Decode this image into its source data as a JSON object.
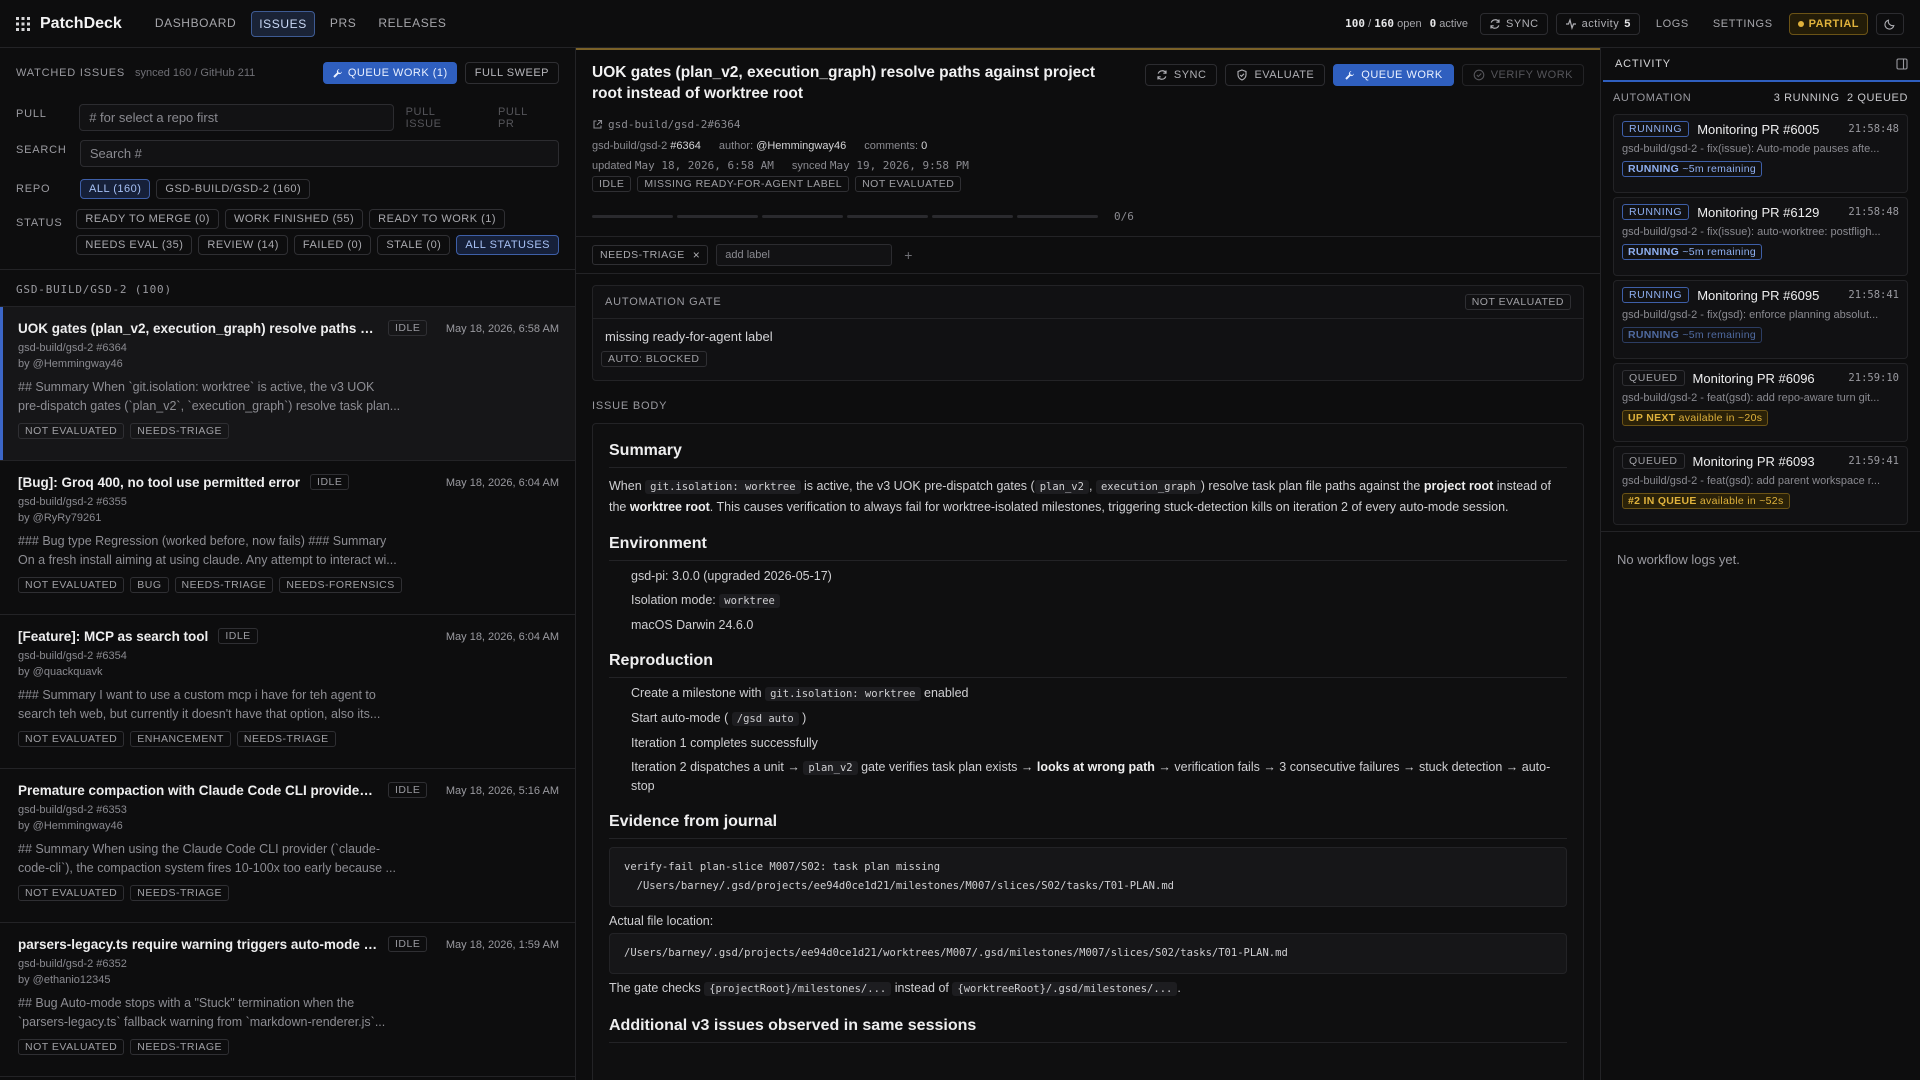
{
  "app": {
    "name": "PatchDeck"
  },
  "nav": [
    "DASHBOARD",
    "ISSUES",
    "PRS",
    "RELEASES"
  ],
  "top": {
    "open_a": "100",
    "open_sep": "/",
    "open_b": "160",
    "open_label": "open",
    "active_num": "0",
    "active_label": "active",
    "sync": "SYNC",
    "activity": "activity",
    "activity_count": "5",
    "logs": "LOGS",
    "settings": "SETTINGS",
    "partial": "PARTIAL"
  },
  "left": {
    "watched": "WATCHED ISSUES",
    "synced": "synced 160 / GitHub 211",
    "queue_btn": "QUEUE WORK (1)",
    "sweep_btn": "FULL SWEEP",
    "pull_label": "PULL",
    "pull_placeholder": "# for select a repo first",
    "pull_issue": "PULL ISSUE",
    "pull_pr": "PULL PR",
    "search_label": "SEARCH",
    "search_placeholder": "Search #",
    "repo_label": "REPO",
    "repos": [
      "ALL (160)",
      "GSD-BUILD/GSD-2 (160)"
    ],
    "status_label": "STATUS",
    "statuses_row1": [
      "READY TO MERGE (0)",
      "WORK FINISHED (55)",
      "READY TO WORK (1)"
    ],
    "statuses_row2": [
      "NEEDS EVAL (35)",
      "REVIEW (14)",
      "FAILED (0)",
      "STALE (0)",
      "ALL STATUSES"
    ],
    "group": "GSD-BUILD/GSD-2 (100)"
  },
  "issues": [
    {
      "title": "UOK gates (plan_v2, execution_graph) resolve paths agai...",
      "state": "IDLE",
      "date": "May 18, 2026, 6:58 AM",
      "repo": "gsd-build/gsd-2 #6364",
      "by": "by @Hemmingway46",
      "l1": "## Summary When `git.isolation: worktree` is active, the v3 UOK",
      "l2": "pre-dispatch gates (`plan_v2`, `execution_graph`) resolve task plan...",
      "tags": [
        "NOT EVALUATED",
        "NEEDS-TRIAGE"
      ]
    },
    {
      "title": "[Bug]: Groq 400, no tool use permitted error",
      "state": "IDLE",
      "date": "May 18, 2026, 6:04 AM",
      "repo": "gsd-build/gsd-2 #6355",
      "by": "by @RyRy79261",
      "l1": "### Bug type Regression (worked before, now fails) ### Summary",
      "l2": "On a fresh install aiming at using claude. Any attempt to interact wi...",
      "tags": [
        "NOT EVALUATED",
        "BUG",
        "NEEDS-TRIAGE",
        "NEEDS-FORENSICS"
      ]
    },
    {
      "title": "[Feature]: MCP as search tool",
      "state": "IDLE",
      "date": "May 18, 2026, 6:04 AM",
      "repo": "gsd-build/gsd-2 #6354",
      "by": "by @quackquavk",
      "l1": "### Summary I want to use a custom mcp i have for teh agent to",
      "l2": "search teh web, but currently it doesn't have that option, also its...",
      "tags": [
        "NOT EVALUATED",
        "ENHANCEMENT",
        "NEEDS-TRIAGE"
      ]
    },
    {
      "title": "Premature compaction with Claude Code CLI provider: cu...",
      "state": "IDLE",
      "date": "May 18, 2026, 5:16 AM",
      "repo": "gsd-build/gsd-2 #6353",
      "by": "by @Hemmingway46",
      "l1": "## Summary When using the Claude Code CLI provider (`claude-",
      "l2": "code-cli`), the compaction system fires 10-100x too early because ...",
      "tags": [
        "NOT EVALUATED",
        "NEEDS-TRIAGE"
      ]
    },
    {
      "title": "parsers-legacy.ts require warning triggers auto-mode stu...",
      "state": "IDLE",
      "date": "May 18, 2026, 1:59 AM",
      "repo": "gsd-build/gsd-2 #6352",
      "by": "by @ethanio12345",
      "l1": "## Bug Auto-mode stops with a \"Stuck\" termination when the",
      "l2": "`parsers-legacy.ts` fallback warning from `markdown-renderer.js`...",
      "tags": [
        "NOT EVALUATED",
        "NEEDS-TRIAGE"
      ]
    }
  ],
  "detail": {
    "title": "UOK gates (plan_v2, execution_graph) resolve paths against project root instead of worktree root",
    "sync": "SYNC",
    "evaluate": "EVALUATE",
    "queue": "QUEUE WORK",
    "verify": "VERIFY WORK",
    "link": "gsd-build/gsd-2#6364",
    "repo": "gsd-build/gsd-2",
    "num": "#6364",
    "author_label": "author:",
    "author": "@Hemmingway46",
    "comments_label": "comments:",
    "comments": "0",
    "updated_label": "updated",
    "updated": "May 18, 2026, 6:58 AM",
    "synced_label": "synced",
    "synced": "May 19, 2026, 9:58 PM",
    "status": [
      "IDLE",
      "MISSING READY-FOR-AGENT LABEL",
      "NOT EVALUATED"
    ],
    "progress": "0/6",
    "label": "NEEDS-TRIAGE",
    "add_label": "add label",
    "gate_title": "AUTOMATION GATE",
    "gate_state": "NOT EVALUATED",
    "gate_msg": "missing ready-for-agent label",
    "gate_auto": "AUTO: BLOCKED",
    "body_head": "ISSUE BODY",
    "b": {
      "h_summary": "Summary",
      "s1": "When",
      "c1": "git.isolation: worktree",
      "s2": "is active, the v3 UOK pre-dispatch gates (",
      "c2": "plan_v2",
      "s3": ",",
      "c3": "execution_graph",
      "s4": ") resolve task plan file paths against the",
      "s5": "project root",
      "s6": "instead of",
      "s7": "the",
      "s8": "worktree root",
      "s9": ". This causes verification to always fail for worktree-isolated milestones, triggering stuck-detection kills on iteration 2 of every auto-mode session.",
      "h_env": "Environment",
      "e1": "gsd-pi: 3.0.0 (upgraded 2026-05-17)",
      "e2": "Isolation mode:",
      "e2c": "worktree",
      "e3": "macOS Darwin 24.6.0",
      "h_repro": "Reproduction",
      "r1": "Create a milestone with",
      "r1c": "git.isolation: worktree",
      "r1b": "enabled",
      "r2": "Start auto-mode (",
      "r2c": "/gsd auto",
      "r2b": ")",
      "r3": "Iteration 1 completes successfully",
      "r4a": "Iteration 2 dispatches a unit →",
      "r4c": "plan_v2",
      "r4b": "gate verifies task plan exists →",
      "r4s": "looks at wrong path",
      "r4d": "→ verification fails → 3 consecutive failures → stuck detection → auto-stop",
      "h_evid": "Evidence from journal",
      "pre1a": "verify-fail plan-slice M007/S02: task plan missing",
      "pre1b": "  /Users/barney/.gsd/projects/ee94d0ce1d21/milestones/M007/slices/S02/tasks/T01-PLAN.md",
      "actual": "Actual file location:",
      "pre2": "/Users/barney/.gsd/projects/ee94d0ce1d21/worktrees/M007/.gsd/milestones/M007/slices/S02/tasks/T01-PLAN.md",
      "g1": "The gate checks",
      "g1c": "{projectRoot}/milestones/...",
      "g2": "instead of",
      "g2c": "{worktreeRoot}/.gsd/milestones/...",
      "g3": ".",
      "h_add": "Additional v3 issues observed in same sessions"
    }
  },
  "activity": {
    "tab": "ACTIVITY",
    "automation": "AUTOMATION",
    "running": "3 RUNNING",
    "queued": "2 QUEUED",
    "cards": [
      {
        "state": "RUNNING",
        "title": "Monitoring PR #6005",
        "time": "21:58:48",
        "desc": "gsd-build/gsd-2 - fix(issue): Auto-mode pauses afte...",
        "bold": "RUNNING",
        "rest": "~5m remaining",
        "style": "blue"
      },
      {
        "state": "RUNNING",
        "title": "Monitoring PR #6129",
        "time": "21:58:48",
        "desc": "gsd-build/gsd-2 - fix(issue): auto-worktree: postfligh...",
        "bold": "RUNNING",
        "rest": "~5m remaining",
        "style": "blue"
      },
      {
        "state": "RUNNING",
        "title": "Monitoring PR #6095",
        "time": "21:58:41",
        "desc": "gsd-build/gsd-2 - fix(gsd): enforce planning absolut...",
        "bold": "RUNNING",
        "rest": "~5m remaining",
        "style": "dim"
      },
      {
        "state": "QUEUED",
        "title": "Monitoring PR #6096",
        "time": "21:59:10",
        "desc": "gsd-build/gsd-2 - feat(gsd): add repo-aware turn git...",
        "bold": "UP NEXT",
        "rest": "available in ~20s",
        "style": "yellow"
      },
      {
        "state": "QUEUED",
        "title": "Monitoring PR #6093",
        "time": "21:59:41",
        "desc": "gsd-build/gsd-2 - feat(gsd): add parent workspace r...",
        "bold": "#2 IN QUEUE",
        "rest": "available in ~52s",
        "style": "yellow"
      }
    ],
    "nologs": "No workflow logs yet."
  }
}
